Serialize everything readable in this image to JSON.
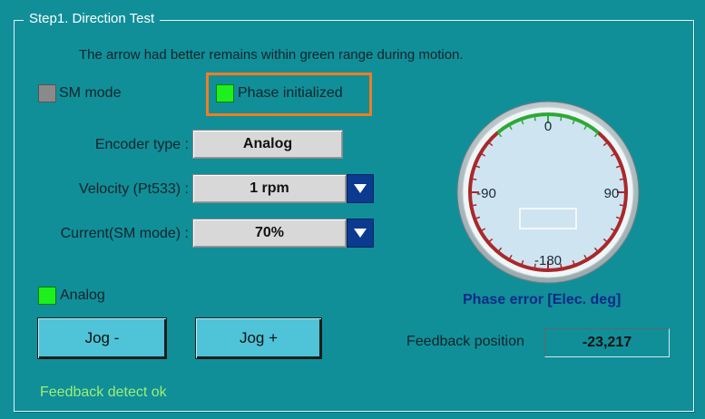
{
  "step": {
    "title": "Step1. Direction Test"
  },
  "instruction": "The arrow had better remains within green range during motion.",
  "indicators": {
    "sm_mode": {
      "label": "SM mode",
      "state": "off"
    },
    "phase_initialized": {
      "label": "Phase initialized",
      "state": "on"
    },
    "analog": {
      "label": "Analog",
      "state": "on"
    }
  },
  "fields": {
    "encoder_type": {
      "label": "Encoder type :",
      "value": "Analog"
    },
    "velocity": {
      "label": "Velocity (Pt533) :",
      "value": "1 rpm"
    },
    "current": {
      "label": "Current(SM mode) :",
      "value": "70%"
    }
  },
  "buttons": {
    "jog_minus": "Jog -",
    "jog_plus": "Jog +"
  },
  "status": "Feedback detect ok",
  "gauge": {
    "caption": "Phase error [Elec. deg]",
    "labels": {
      "top": "0",
      "left": "-90",
      "right": "90",
      "bottom": "-180"
    },
    "readout": ""
  },
  "feedback": {
    "label": "Feedback position",
    "value": "-23,217"
  },
  "colors": {
    "background": "#108f99",
    "highlight": "#ef7d22",
    "led_on": "#1ef01e",
    "led_off": "#8a8a8a",
    "dropdown": "#0b3a8f",
    "button": "#4fc3d7",
    "status_text": "#9fee74",
    "gauge_green": "#2ea836",
    "gauge_red": "#a8292b",
    "caption": "#0c2a86"
  }
}
